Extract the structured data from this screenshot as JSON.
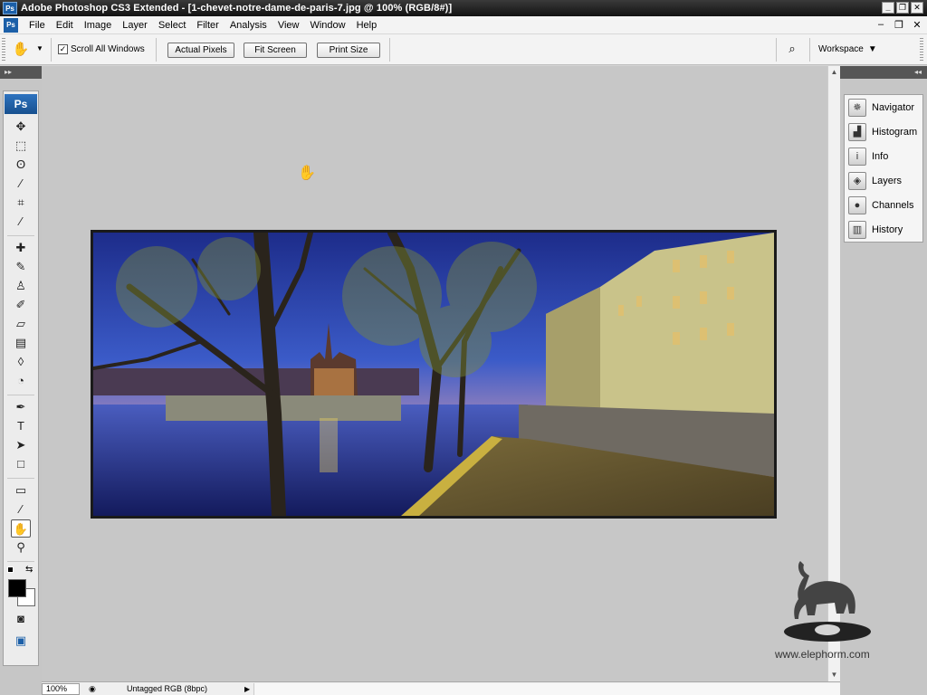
{
  "window": {
    "title": "Adobe Photoshop CS3 Extended - [1-chevet-notre-dame-de-paris-7.jpg @ 100% (RGB/8#)]",
    "logo": "Ps",
    "controls": [
      "_",
      "❐",
      "✕"
    ]
  },
  "menu": {
    "items": [
      "File",
      "Edit",
      "Image",
      "Layer",
      "Select",
      "Filter",
      "Analysis",
      "View",
      "Window",
      "Help"
    ],
    "doc_controls": [
      "–",
      "❐",
      "✕"
    ]
  },
  "options": {
    "scroll_all_windows_label": "Scroll All Windows",
    "scroll_all_windows_checked": true,
    "actual_pixels": "Actual Pixels",
    "fit_screen": "Fit Screen",
    "print_size": "Print Size",
    "workspace_label": "Workspace"
  },
  "tools": {
    "logo": "Ps",
    "items": [
      {
        "name": "move-tool-icon",
        "glyph": "✥"
      },
      {
        "name": "marquee-tool-icon",
        "glyph": "⬚"
      },
      {
        "name": "lasso-tool-icon",
        "glyph": "ʘ"
      },
      {
        "name": "magic-wand-tool-icon",
        "glyph": "⁄"
      },
      {
        "name": "crop-tool-icon",
        "glyph": "⌗"
      },
      {
        "name": "slice-tool-icon",
        "glyph": "∕"
      },
      {
        "name": "healing-brush-tool-icon",
        "glyph": "✚"
      },
      {
        "name": "brush-tool-icon",
        "glyph": "✎"
      },
      {
        "name": "clone-stamp-tool-icon",
        "glyph": "♙"
      },
      {
        "name": "history-brush-tool-icon",
        "glyph": "✐"
      },
      {
        "name": "eraser-tool-icon",
        "glyph": "▱"
      },
      {
        "name": "gradient-tool-icon",
        "glyph": "▤"
      },
      {
        "name": "blur-tool-icon",
        "glyph": "◊"
      },
      {
        "name": "dodge-tool-icon",
        "glyph": "◔"
      },
      {
        "name": "pen-tool-icon",
        "glyph": "✒"
      },
      {
        "name": "type-tool-icon",
        "glyph": "T"
      },
      {
        "name": "path-selection-tool-icon",
        "glyph": "➤"
      },
      {
        "name": "shape-tool-icon",
        "glyph": "□"
      },
      {
        "name": "notes-tool-icon",
        "glyph": "▭"
      },
      {
        "name": "eyedropper-tool-icon",
        "glyph": "⁄"
      },
      {
        "name": "hand-tool-icon",
        "glyph": "✋",
        "active": true
      },
      {
        "name": "zoom-tool-icon",
        "glyph": "⚲"
      }
    ],
    "quick_mask_glyph": "◙",
    "screen_mode_glyph": "▣",
    "swap_glyph": "⇆"
  },
  "panels": {
    "items": [
      {
        "label": "Navigator",
        "icon": "navigator-icon",
        "glyph": "✵"
      },
      {
        "label": "Histogram",
        "icon": "histogram-icon",
        "glyph": "▟"
      },
      {
        "label": "Info",
        "icon": "info-icon",
        "glyph": "i"
      },
      {
        "label": "Layers",
        "icon": "layers-icon",
        "glyph": "◈"
      },
      {
        "label": "Channels",
        "icon": "channels-icon",
        "glyph": "●"
      },
      {
        "label": "History",
        "icon": "history-icon",
        "glyph": "▥"
      }
    ]
  },
  "status": {
    "zoom": "100%",
    "doc_info": "Untagged RGB (8bpc)"
  },
  "watermark": {
    "url": "www.elephorm.com"
  },
  "colors": {
    "foreground": "#000000",
    "background": "#ffffff",
    "accent": "#1b5fa8"
  }
}
